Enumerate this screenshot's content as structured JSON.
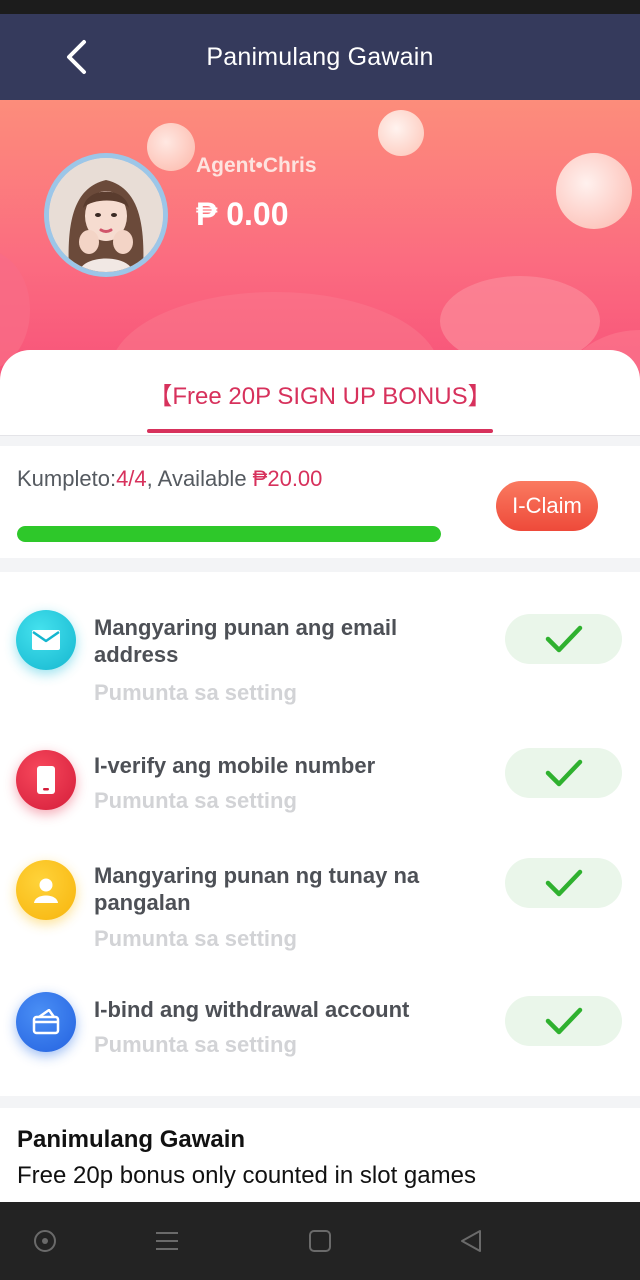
{
  "header": {
    "title": "Panimulang Gawain",
    "back_icon": "chevron-left-icon"
  },
  "profile": {
    "agent_name": "Agent•Chris",
    "balance": "₱ 0.00"
  },
  "tab": {
    "label": "【Free 20P SIGN UP BONUS】"
  },
  "progress": {
    "label_prefix": "Kumpleto:",
    "completed": "4/4",
    "available_label": ", Available ",
    "available_amount": "₱20.00",
    "claim_label": "I-Claim",
    "fraction": 1.0
  },
  "tasks": [
    {
      "icon": "envelope-icon",
      "title": "Mangyaring punan ang email address",
      "subtitle": "Pumunta sa setting",
      "done": true
    },
    {
      "icon": "mobile-phone-icon",
      "title": "I-verify ang mobile number",
      "subtitle": "Pumunta sa setting",
      "done": true
    },
    {
      "icon": "user-icon",
      "title": "Mangyaring punan ng tunay na pangalan",
      "subtitle": "Pumunta sa setting",
      "done": true
    },
    {
      "icon": "bank-card-icon",
      "title": "I-bind ang withdrawal account",
      "subtitle": "Pumunta sa setting",
      "done": true
    }
  ],
  "footer": {
    "title": "Panimulang Gawain",
    "description": "Free 20p bonus only counted in slot games"
  },
  "colors": {
    "header_bg": "#353a5c",
    "accent": "#d7315c",
    "progress_green": "#2ec82a",
    "claim_button": "#ee4a3a"
  }
}
